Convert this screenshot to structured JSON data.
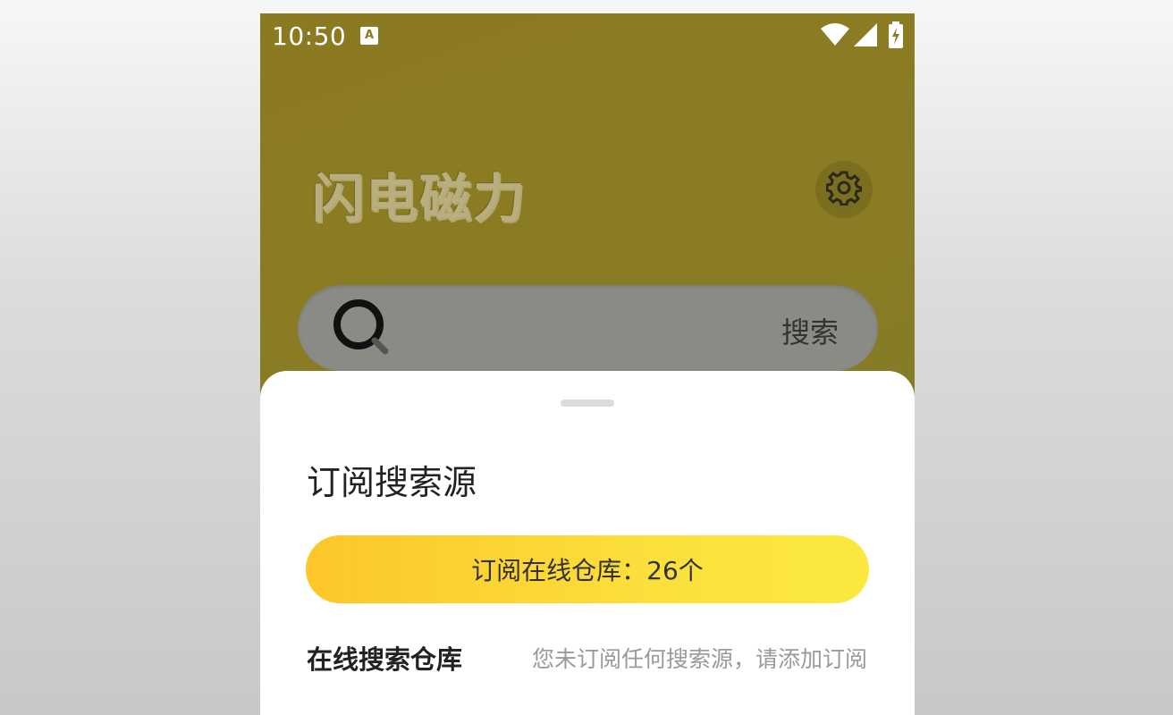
{
  "status_bar": {
    "time": "10:50",
    "notification_glyph": "A",
    "icons": [
      "wifi-icon",
      "signal-icon",
      "battery-charging-icon"
    ]
  },
  "app": {
    "title": "闪电磁力",
    "settings_icon": "gear-icon"
  },
  "search": {
    "icon": "search-icon",
    "button_label": "搜索"
  },
  "sheet": {
    "title": "订阅搜索源",
    "subscribe_button_label": "订阅在线仓库：26个",
    "online_repo_label": "在线搜索仓库",
    "online_repo_hint": "您未订阅任何搜索源，请添加订阅"
  },
  "colors": {
    "header_background": "#8a7c24",
    "accent_yellow": "#fbd834",
    "sheet_background": "#ffffff"
  }
}
